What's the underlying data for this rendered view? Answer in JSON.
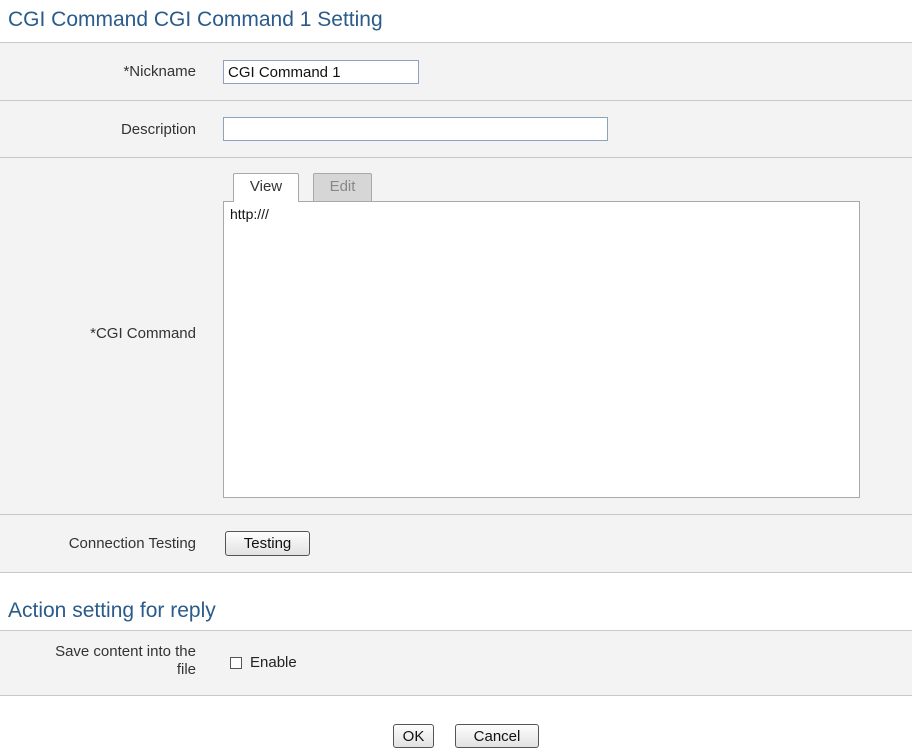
{
  "header": {
    "title": "CGI Command CGI Command 1 Setting"
  },
  "fields": {
    "nickname": {
      "label": "*Nickname",
      "value": "CGI Command 1"
    },
    "description": {
      "label": "Description",
      "value": ""
    },
    "cgi_command": {
      "label": "*CGI Command",
      "tabs": [
        {
          "label": "View",
          "active": true
        },
        {
          "label": "Edit",
          "active": false
        }
      ],
      "content": "http:///"
    },
    "connection_testing": {
      "label": "Connection Testing",
      "button_label": "Testing"
    }
  },
  "reply_section": {
    "title": "Action setting for reply",
    "save_content": {
      "label_line1": "Save content into the",
      "label_line2": "file",
      "checkbox_label": "Enable",
      "checked": false
    }
  },
  "footer": {
    "ok_label": "OK",
    "cancel_label": "Cancel"
  }
}
